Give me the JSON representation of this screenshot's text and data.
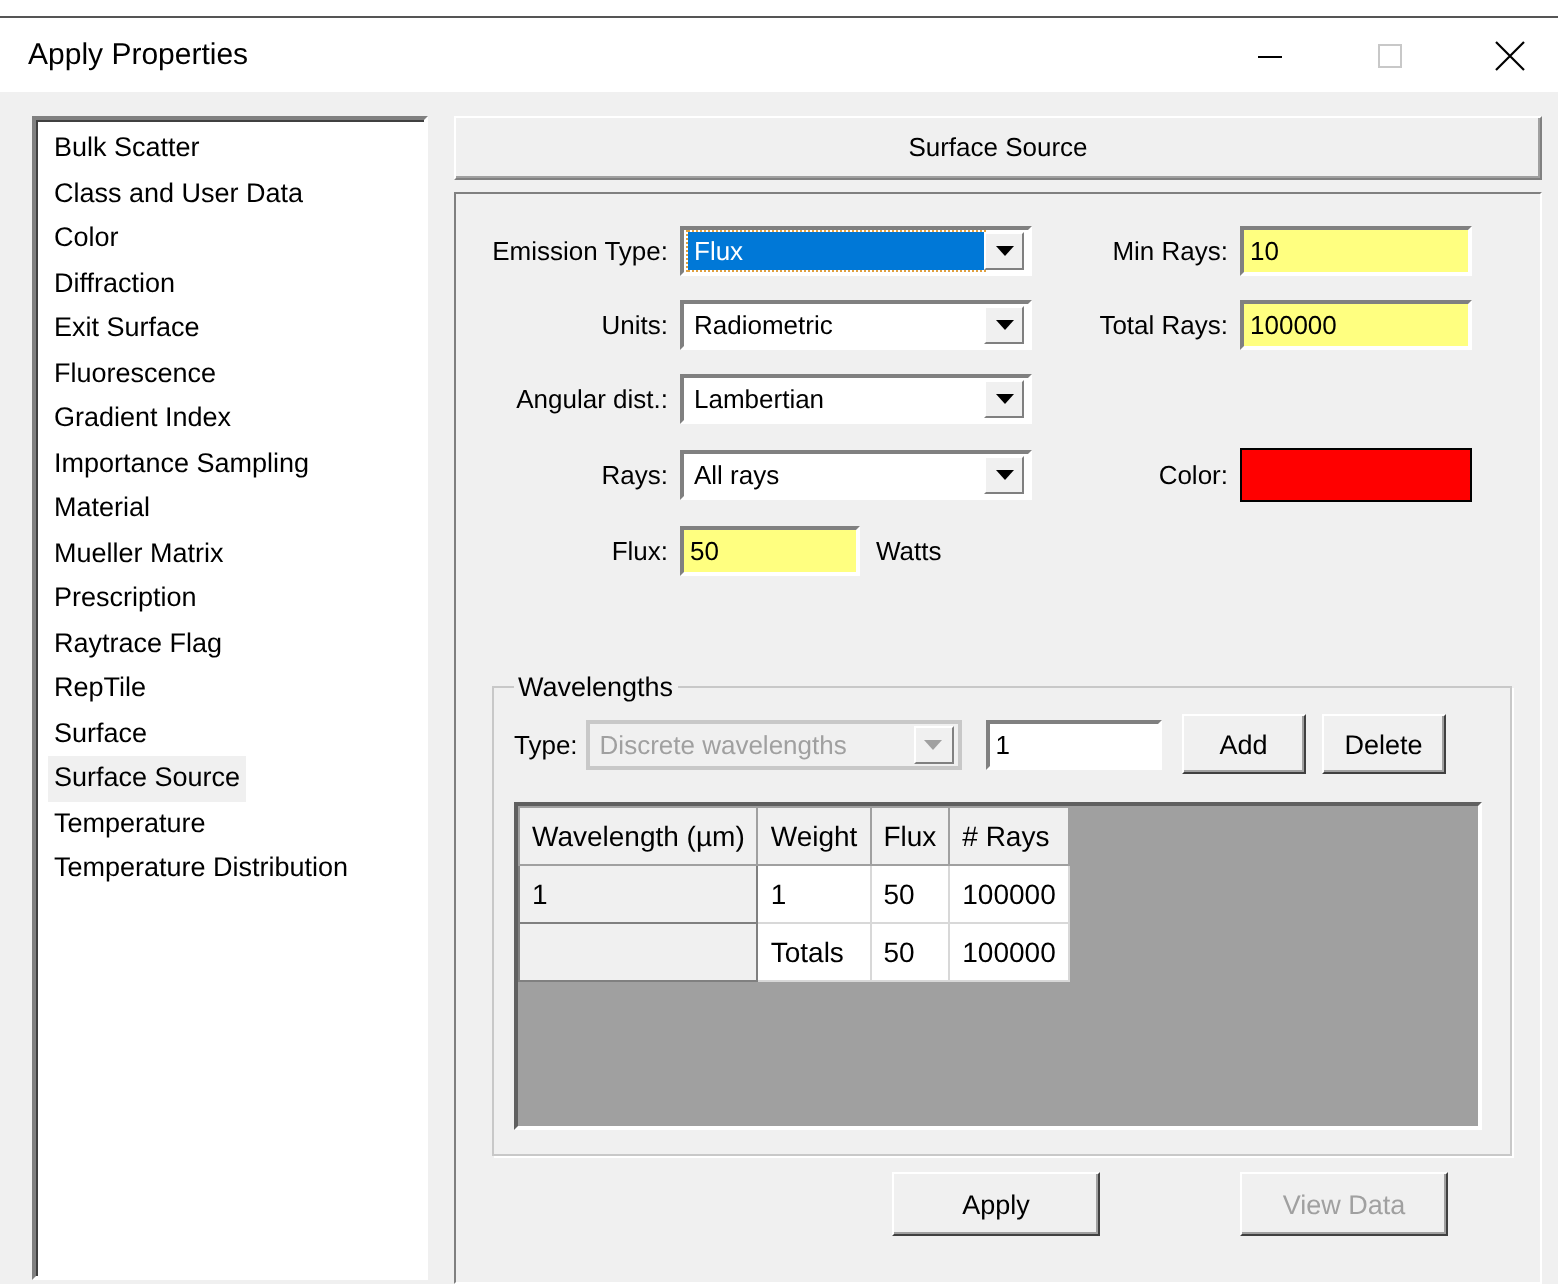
{
  "window": {
    "title": "Apply Properties"
  },
  "sidebar": {
    "items": [
      {
        "label": "Bulk Scatter",
        "selected": false
      },
      {
        "label": "Class and User Data",
        "selected": false
      },
      {
        "label": "Color",
        "selected": false
      },
      {
        "label": "Diffraction",
        "selected": false
      },
      {
        "label": "Exit Surface",
        "selected": false
      },
      {
        "label": "Fluorescence",
        "selected": false
      },
      {
        "label": "Gradient Index",
        "selected": false
      },
      {
        "label": "Importance Sampling",
        "selected": false
      },
      {
        "label": "Material",
        "selected": false
      },
      {
        "label": "Mueller Matrix",
        "selected": false
      },
      {
        "label": "Prescription",
        "selected": false
      },
      {
        "label": "Raytrace Flag",
        "selected": false
      },
      {
        "label": "RepTile",
        "selected": false
      },
      {
        "label": "Surface",
        "selected": false
      },
      {
        "label": "Surface Source",
        "selected": true
      },
      {
        "label": "Temperature",
        "selected": false
      },
      {
        "label": "Temperature Distribution",
        "selected": false
      }
    ]
  },
  "panel": {
    "title": "Surface Source"
  },
  "form": {
    "rows": [
      {
        "left": {
          "label": "Emission Type:",
          "kind": "combo",
          "value": "Flux",
          "focused": true
        },
        "right": {
          "label": "Min Rays:",
          "kind": "input",
          "value": "10"
        }
      },
      {
        "left": {
          "label": "Units:",
          "kind": "combo",
          "value": "Radiometric",
          "focused": false
        },
        "right": {
          "label": "Total Rays:",
          "kind": "input",
          "value": "100000"
        }
      },
      {
        "left": {
          "label": "Angular dist.:",
          "kind": "combo",
          "value": "Lambertian",
          "focused": false
        }
      },
      {
        "left": {
          "label": "Rays:",
          "kind": "combo",
          "value": "All rays",
          "focused": false
        },
        "right": {
          "label": "Color:",
          "kind": "color",
          "color": "#ff0000"
        }
      },
      {
        "left": {
          "label": "Flux:",
          "kind": "input",
          "value": "50",
          "unit": "Watts"
        }
      }
    ]
  },
  "wavelengths": {
    "title": "Wavelengths",
    "type_label": "Type:",
    "type_value": "Discrete wavelengths",
    "type_disabled": true,
    "entry": "1",
    "buttons": [
      "Add",
      "Delete"
    ],
    "table": {
      "columns": [
        "Wavelength (µm)",
        "Weight",
        "Flux",
        "# Rays"
      ],
      "rows": [
        [
          "1",
          "1",
          "50",
          "100000"
        ],
        [
          "",
          "Totals",
          "50",
          "100000"
        ]
      ]
    }
  },
  "buttons": [
    {
      "label": "Apply",
      "disabled": false
    },
    {
      "label": "View Data",
      "disabled": true
    }
  ]
}
